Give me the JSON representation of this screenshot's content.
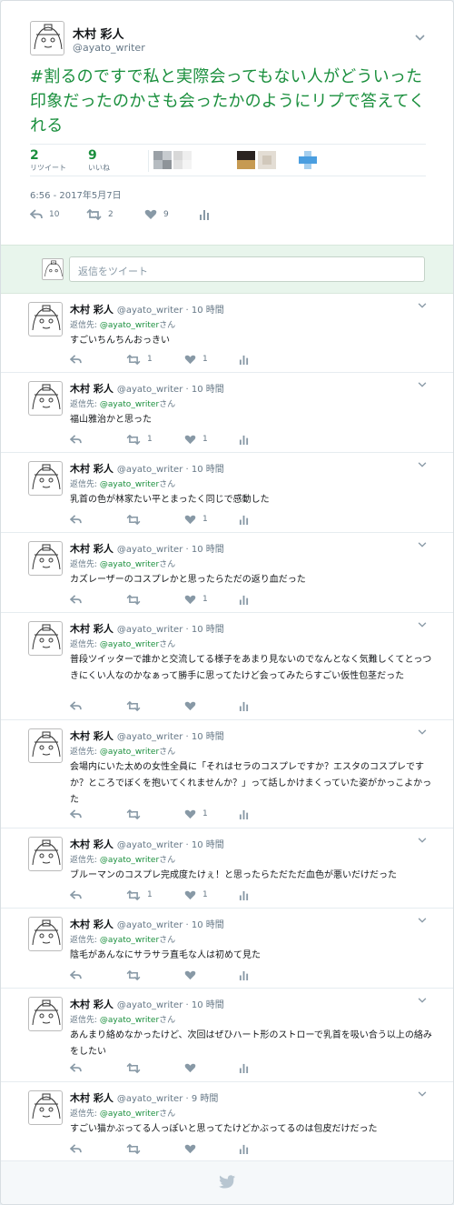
{
  "main_tweet": {
    "author_name": "木村 彩人",
    "author_handle": "@ayato_writer",
    "text": "#割るのですで私と実際会ってもない人がどういった印象だったのかさも会ったかのようにリプで答えてくれる",
    "retweets": {
      "count": "2",
      "label": "リツイート"
    },
    "likes": {
      "count": "9",
      "label": "いいね"
    },
    "timestamp": "6:56 - 2017年5月7日",
    "reply_count": "10",
    "retweet_count": "2",
    "like_count": "9"
  },
  "reply_box": {
    "placeholder": "返信をツイート"
  },
  "replies": [
    {
      "name": "木村 彩人",
      "handle": "@ayato_writer",
      "time": "10 時間",
      "reply_to_label": "返信先:",
      "reply_to": "@ayato_writer",
      "reply_to_suffix": "さん",
      "text": "すごいちんちんおっきい",
      "retweets": "1",
      "likes": "1"
    },
    {
      "name": "木村 彩人",
      "handle": "@ayato_writer",
      "time": "10 時間",
      "reply_to_label": "返信先:",
      "reply_to": "@ayato_writer",
      "reply_to_suffix": "さん",
      "text": "福山雅治かと思った",
      "retweets": "1",
      "likes": "1"
    },
    {
      "name": "木村 彩人",
      "handle": "@ayato_writer",
      "time": "10 時間",
      "reply_to_label": "返信先:",
      "reply_to": "@ayato_writer",
      "reply_to_suffix": "さん",
      "text": "乳首の色が林家たい平とまったく同じで感動した",
      "retweets": "",
      "likes": "1"
    },
    {
      "name": "木村 彩人",
      "handle": "@ayato_writer",
      "time": "10 時間",
      "reply_to_label": "返信先:",
      "reply_to": "@ayato_writer",
      "reply_to_suffix": "さん",
      "text": "カズレーザーのコスプレかと思ったらただの返り血だった",
      "retweets": "",
      "likes": "1"
    },
    {
      "name": "木村 彩人",
      "handle": "@ayato_writer",
      "time": "10 時間",
      "reply_to_label": "返信先:",
      "reply_to": "@ayato_writer",
      "reply_to_suffix": "さん",
      "text": "普段ツイッターで誰かと交流してる様子をあまり見ないのでなんとなく気難しくてとっつきにくい人なのかなぁって勝手に思ってたけど会ってみたらすごい仮性包茎だった",
      "retweets": "",
      "likes": ""
    },
    {
      "name": "木村 彩人",
      "handle": "@ayato_writer",
      "time": "10 時間",
      "reply_to_label": "返信先:",
      "reply_to": "@ayato_writer",
      "reply_to_suffix": "さん",
      "text": "会場内にいた太めの女性全員に「それはセラのコスプレですか？エスタのコスプレですか？ところでぼくを抱いてくれませんか？」って話しかけまくっていた姿がかっこよかった",
      "retweets": "",
      "likes": "1"
    },
    {
      "name": "木村 彩人",
      "handle": "@ayato_writer",
      "time": "10 時間",
      "reply_to_label": "返信先:",
      "reply_to": "@ayato_writer",
      "reply_to_suffix": "さん",
      "text": "ブルーマンのコスプレ完成度たけぇ！と思ったらただただ血色が悪いだけだった",
      "retweets": "1",
      "likes": "1"
    },
    {
      "name": "木村 彩人",
      "handle": "@ayato_writer",
      "time": "10 時間",
      "reply_to_label": "返信先:",
      "reply_to": "@ayato_writer",
      "reply_to_suffix": "さん",
      "text": "陰毛があんなにサラサラ直毛な人は初めて見た",
      "retweets": "",
      "likes": ""
    },
    {
      "name": "木村 彩人",
      "handle": "@ayato_writer",
      "time": "10 時間",
      "reply_to_label": "返信先:",
      "reply_to": "@ayato_writer",
      "reply_to_suffix": "さん",
      "text": "あんまり絡めなかったけど、次回はぜひハート形のストローで乳首を吸い合う以上の絡みをしたい",
      "retweets": "",
      "likes": ""
    },
    {
      "name": "木村 彩人",
      "handle": "@ayato_writer",
      "time": "9 時間",
      "reply_to_label": "返信先:",
      "reply_to": "@ayato_writer",
      "reply_to_suffix": "さん",
      "text": "すごい猫かぶってる人っぽいと思ってたけどかぶってるのは包皮だけだった",
      "retweets": "",
      "likes": ""
    }
  ],
  "colors": {
    "accent": "#1a8f3d",
    "reply_bg": "#e8f5ec",
    "muted": "#657786"
  }
}
